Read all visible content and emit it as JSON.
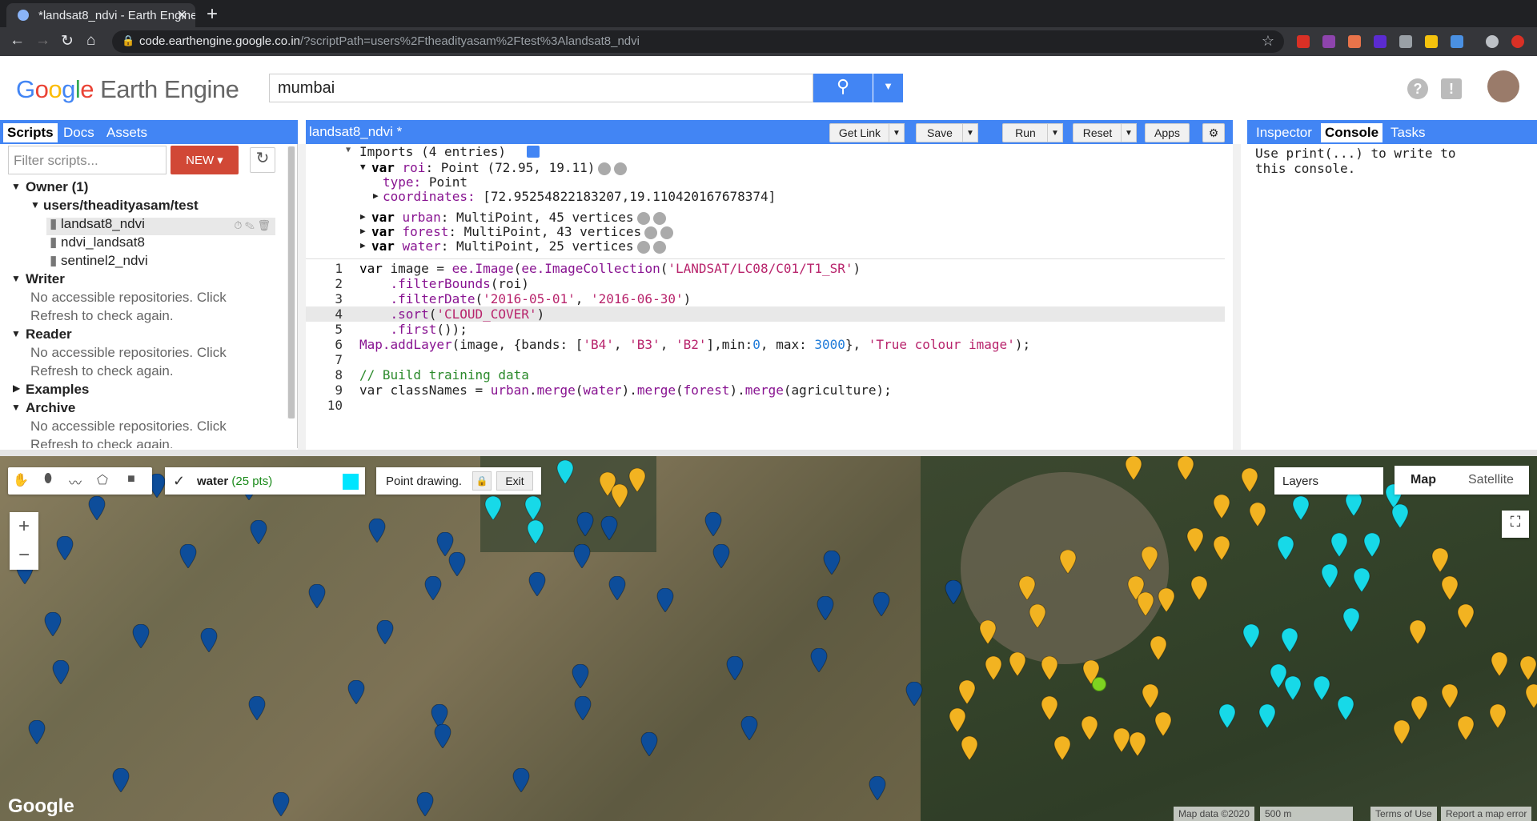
{
  "browser": {
    "tab_title": "*landsat8_ndvi - Earth Engine",
    "url_host": "code.earthengine.google.co.in",
    "url_path": "/?scriptPath=users%2Ftheadityasam%2Ftest%3Alandsat8_ndvi"
  },
  "header": {
    "logo": "Google Earth Engine",
    "search_value": "mumbai"
  },
  "left_panel": {
    "tabs": [
      "Scripts",
      "Docs",
      "Assets"
    ],
    "filter_placeholder": "Filter scripts...",
    "new_label": "NEW",
    "tree": {
      "owner": "Owner  (1)",
      "repo": "users/theadityasam/test",
      "files": [
        "landsat8_ndvi",
        "ndvi_landsat8",
        "sentinel2_ndvi"
      ],
      "writer": "Writer",
      "writer_msg1": "No accessible repositories. Click",
      "writer_msg2": "Refresh to check again.",
      "reader": "Reader",
      "reader_msg1": "No accessible repositories. Click",
      "reader_msg2": "Refresh to check again.",
      "examples": "Examples",
      "archive": "Archive",
      "archive_msg1": "No accessible repositories. Click",
      "archive_msg2": "Refresh to check again."
    }
  },
  "editor": {
    "title": "landsat8_ndvi *",
    "buttons": {
      "get_link": "Get Link",
      "save": "Save",
      "run": "Run",
      "reset": "Reset",
      "apps": "Apps"
    },
    "imports": {
      "header": "Imports (4 entries)",
      "roi_name": "roi",
      "roi_val": "Point (72.95, 19.11)",
      "roi_type_label": "type:",
      "roi_type": "Point",
      "roi_coord_label": "coordinates:",
      "roi_coords": "[72.95254822183207,19.110420167678374]",
      "urban_name": "urban",
      "urban_val": "MultiPoint, 45 vertices",
      "forest_name": "forest",
      "forest_val": "MultiPoint, 43 vertices",
      "water_name": "water",
      "water_val": "MultiPoint, 25 vertices"
    },
    "line_numbers": [
      "1",
      "2",
      "3",
      "4",
      "5",
      "6",
      "7",
      "8",
      "9",
      "10"
    ]
  },
  "right_panel": {
    "tabs": [
      "Inspector",
      "Console",
      "Tasks"
    ],
    "console_msg": "Use print(...) to write to\nthis console."
  },
  "map": {
    "layer_name": "water",
    "layer_count": "(25 pts)",
    "drawing_label": "Point drawing.",
    "exit_label": "Exit",
    "layers_label": "Layers",
    "map_label": "Map",
    "satellite_label": "Satellite",
    "google_label": "Google",
    "map_data": "Map data ©2020",
    "scale": "500 m",
    "terms": "Terms of Use",
    "report": "Report a map error",
    "colors": {
      "urban": "#0d4d9a",
      "forest": "#f2b321",
      "water": "#17d9e8",
      "selected": "#7ed321"
    }
  }
}
